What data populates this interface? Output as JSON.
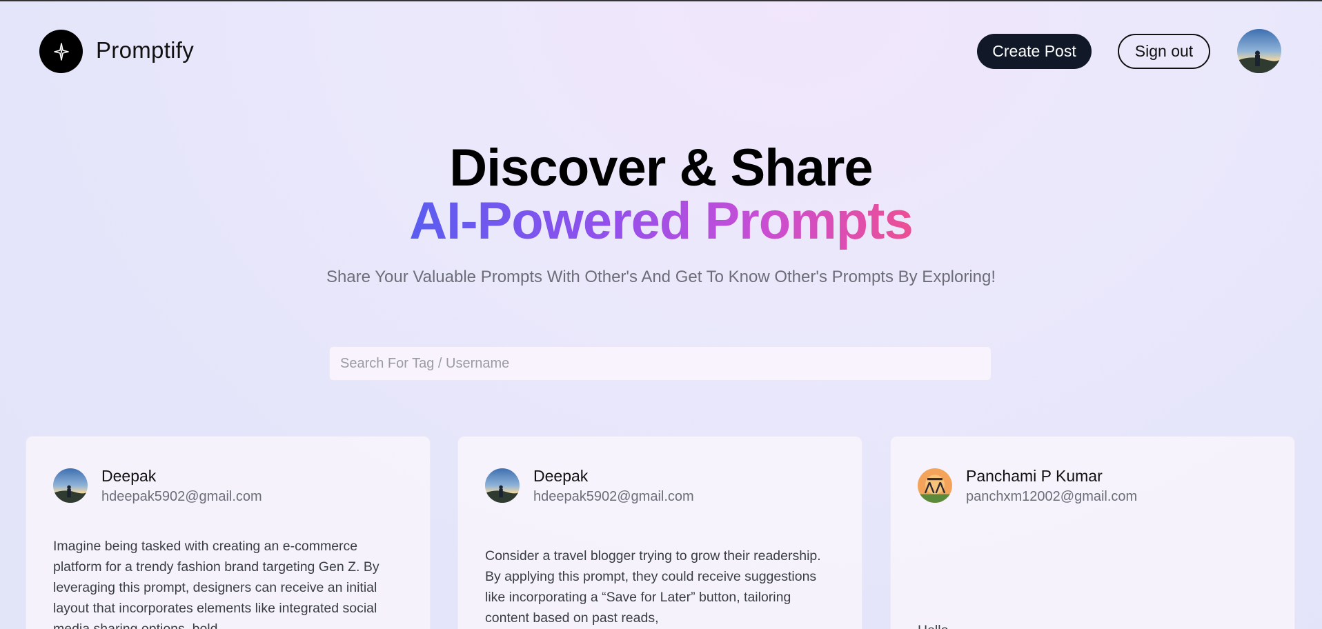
{
  "header": {
    "brand": "Promptify",
    "create_post_label": "Create Post",
    "sign_out_label": "Sign out"
  },
  "hero": {
    "line1": "Discover & Share",
    "line2": "AI-Powered Prompts",
    "subtitle": "Share Your Valuable Prompts With Other's And Get To Know Other's Prompts By Exploring!"
  },
  "search": {
    "placeholder": "Search For Tag / Username",
    "value": ""
  },
  "posts": [
    {
      "name": "Deepak",
      "email": "hdeepak5902@gmail.com",
      "text": "Imagine being tasked with creating an e-commerce platform for a trendy fashion brand targeting Gen Z. By leveraging this prompt, designers can receive an initial layout that incorporates elements like integrated social media sharing options, bold"
    },
    {
      "name": "Deepak",
      "email": "hdeepak5902@gmail.com",
      "text": "Consider a travel blogger trying to grow their readership. By applying this prompt, they could receive suggestions like incorporating a “Save for Later” button, tailoring content based on past reads,"
    },
    {
      "name": "Panchami P Kumar",
      "email": "panchxm12002@gmail.com",
      "text": "Hello"
    }
  ],
  "colors": {
    "primary_button": "#111827",
    "gradient_start": "#5a5df0",
    "gradient_end": "#ec4f94"
  }
}
